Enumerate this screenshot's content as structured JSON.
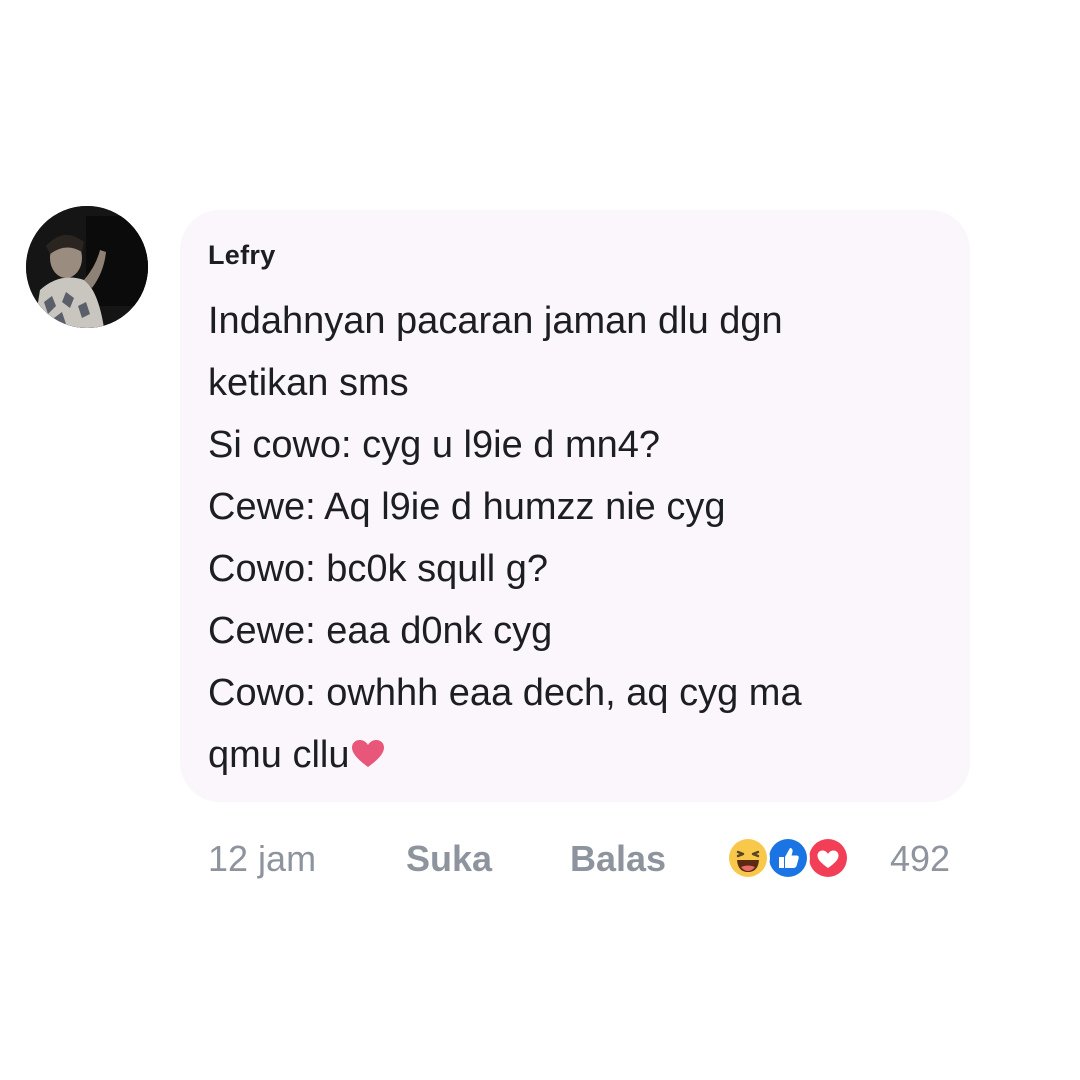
{
  "comment": {
    "author": "Lefry",
    "lines": [
      "Indahnyan pacaran jaman dlu dgn",
      "ketikan sms",
      "Si cowo: cyg u l9ie d mn4?",
      "Cewe: Aq l9ie d humzz nie cyg",
      "Cowo: bc0k squll g?",
      "Cewe: eaa d0nk cyg",
      "Cowo: owhhh eaa dech, aq cyg ma",
      "qmu cllu"
    ],
    "trailing_icon": "heart-icon"
  },
  "actions": {
    "timestamp": "12 jam",
    "like_label": "Suka",
    "reply_label": "Balas",
    "reaction_icons": [
      "haha-icon",
      "like-icon",
      "love-icon"
    ],
    "reaction_count": "492"
  },
  "colors": {
    "bubble_background": "#fbf6fb",
    "text": "#1c1e21",
    "meta_text": "#8d949e",
    "heart": "#e8577a",
    "like_blue": "#1b74e4",
    "love_red": "#f33e58",
    "haha_yellow": "#f7c84a"
  }
}
